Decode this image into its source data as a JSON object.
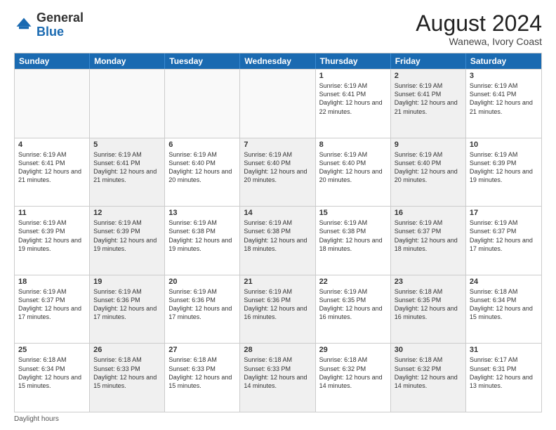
{
  "logo": {
    "general": "General",
    "blue": "Blue"
  },
  "title": {
    "month_year": "August 2024",
    "location": "Wanewa, Ivory Coast"
  },
  "days_of_week": [
    "Sunday",
    "Monday",
    "Tuesday",
    "Wednesday",
    "Thursday",
    "Friday",
    "Saturday"
  ],
  "weeks": [
    [
      {
        "day": "",
        "text": "",
        "shaded": false
      },
      {
        "day": "",
        "text": "",
        "shaded": false
      },
      {
        "day": "",
        "text": "",
        "shaded": false
      },
      {
        "day": "",
        "text": "",
        "shaded": false
      },
      {
        "day": "1",
        "text": "Sunrise: 6:19 AM\nSunset: 6:41 PM\nDaylight: 12 hours and 22 minutes.",
        "shaded": false
      },
      {
        "day": "2",
        "text": "Sunrise: 6:19 AM\nSunset: 6:41 PM\nDaylight: 12 hours and 21 minutes.",
        "shaded": true
      },
      {
        "day": "3",
        "text": "Sunrise: 6:19 AM\nSunset: 6:41 PM\nDaylight: 12 hours and 21 minutes.",
        "shaded": false
      }
    ],
    [
      {
        "day": "4",
        "text": "Sunrise: 6:19 AM\nSunset: 6:41 PM\nDaylight: 12 hours and 21 minutes.",
        "shaded": false
      },
      {
        "day": "5",
        "text": "Sunrise: 6:19 AM\nSunset: 6:41 PM\nDaylight: 12 hours and 21 minutes.",
        "shaded": true
      },
      {
        "day": "6",
        "text": "Sunrise: 6:19 AM\nSunset: 6:40 PM\nDaylight: 12 hours and 20 minutes.",
        "shaded": false
      },
      {
        "day": "7",
        "text": "Sunrise: 6:19 AM\nSunset: 6:40 PM\nDaylight: 12 hours and 20 minutes.",
        "shaded": true
      },
      {
        "day": "8",
        "text": "Sunrise: 6:19 AM\nSunset: 6:40 PM\nDaylight: 12 hours and 20 minutes.",
        "shaded": false
      },
      {
        "day": "9",
        "text": "Sunrise: 6:19 AM\nSunset: 6:40 PM\nDaylight: 12 hours and 20 minutes.",
        "shaded": true
      },
      {
        "day": "10",
        "text": "Sunrise: 6:19 AM\nSunset: 6:39 PM\nDaylight: 12 hours and 19 minutes.",
        "shaded": false
      }
    ],
    [
      {
        "day": "11",
        "text": "Sunrise: 6:19 AM\nSunset: 6:39 PM\nDaylight: 12 hours and 19 minutes.",
        "shaded": false
      },
      {
        "day": "12",
        "text": "Sunrise: 6:19 AM\nSunset: 6:39 PM\nDaylight: 12 hours and 19 minutes.",
        "shaded": true
      },
      {
        "day": "13",
        "text": "Sunrise: 6:19 AM\nSunset: 6:38 PM\nDaylight: 12 hours and 19 minutes.",
        "shaded": false
      },
      {
        "day": "14",
        "text": "Sunrise: 6:19 AM\nSunset: 6:38 PM\nDaylight: 12 hours and 18 minutes.",
        "shaded": true
      },
      {
        "day": "15",
        "text": "Sunrise: 6:19 AM\nSunset: 6:38 PM\nDaylight: 12 hours and 18 minutes.",
        "shaded": false
      },
      {
        "day": "16",
        "text": "Sunrise: 6:19 AM\nSunset: 6:37 PM\nDaylight: 12 hours and 18 minutes.",
        "shaded": true
      },
      {
        "day": "17",
        "text": "Sunrise: 6:19 AM\nSunset: 6:37 PM\nDaylight: 12 hours and 17 minutes.",
        "shaded": false
      }
    ],
    [
      {
        "day": "18",
        "text": "Sunrise: 6:19 AM\nSunset: 6:37 PM\nDaylight: 12 hours and 17 minutes.",
        "shaded": false
      },
      {
        "day": "19",
        "text": "Sunrise: 6:19 AM\nSunset: 6:36 PM\nDaylight: 12 hours and 17 minutes.",
        "shaded": true
      },
      {
        "day": "20",
        "text": "Sunrise: 6:19 AM\nSunset: 6:36 PM\nDaylight: 12 hours and 17 minutes.",
        "shaded": false
      },
      {
        "day": "21",
        "text": "Sunrise: 6:19 AM\nSunset: 6:36 PM\nDaylight: 12 hours and 16 minutes.",
        "shaded": true
      },
      {
        "day": "22",
        "text": "Sunrise: 6:19 AM\nSunset: 6:35 PM\nDaylight: 12 hours and 16 minutes.",
        "shaded": false
      },
      {
        "day": "23",
        "text": "Sunrise: 6:18 AM\nSunset: 6:35 PM\nDaylight: 12 hours and 16 minutes.",
        "shaded": true
      },
      {
        "day": "24",
        "text": "Sunrise: 6:18 AM\nSunset: 6:34 PM\nDaylight: 12 hours and 15 minutes.",
        "shaded": false
      }
    ],
    [
      {
        "day": "25",
        "text": "Sunrise: 6:18 AM\nSunset: 6:34 PM\nDaylight: 12 hours and 15 minutes.",
        "shaded": false
      },
      {
        "day": "26",
        "text": "Sunrise: 6:18 AM\nSunset: 6:33 PM\nDaylight: 12 hours and 15 minutes.",
        "shaded": true
      },
      {
        "day": "27",
        "text": "Sunrise: 6:18 AM\nSunset: 6:33 PM\nDaylight: 12 hours and 15 minutes.",
        "shaded": false
      },
      {
        "day": "28",
        "text": "Sunrise: 6:18 AM\nSunset: 6:33 PM\nDaylight: 12 hours and 14 minutes.",
        "shaded": true
      },
      {
        "day": "29",
        "text": "Sunrise: 6:18 AM\nSunset: 6:32 PM\nDaylight: 12 hours and 14 minutes.",
        "shaded": false
      },
      {
        "day": "30",
        "text": "Sunrise: 6:18 AM\nSunset: 6:32 PM\nDaylight: 12 hours and 14 minutes.",
        "shaded": true
      },
      {
        "day": "31",
        "text": "Sunrise: 6:17 AM\nSunset: 6:31 PM\nDaylight: 12 hours and 13 minutes.",
        "shaded": false
      }
    ]
  ],
  "footer": {
    "label": "Daylight hours"
  }
}
